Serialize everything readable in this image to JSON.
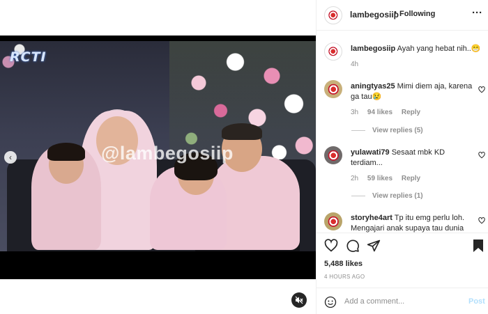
{
  "video": {
    "channel_logo": "RCTI",
    "watermark": "@lambegosiip",
    "prev_icon": "chevron-left-icon",
    "mute_icon": "speaker-muted-icon"
  },
  "header": {
    "username": "lambegosiip",
    "separator": "•",
    "follow_status": "Following",
    "more": "···"
  },
  "caption": {
    "username": "lambegosiip",
    "text": "Ayah yang hebat nih..😁",
    "time": "4h"
  },
  "comments": [
    {
      "username": "aningtyas25",
      "text": "Mimi diem aja, karena ga tau😢",
      "time": "3h",
      "likes": "94 likes",
      "reply_label": "Reply",
      "view_replies": "View replies (5)"
    },
    {
      "username": "yulawati79",
      "text": "Sesaat mbk KD terdiam...",
      "time": "2h",
      "likes": "59 likes",
      "reply_label": "Reply",
      "view_replies": "View replies (1)"
    },
    {
      "username": "storyhe4art",
      "text": "Tp itu emg perlu loh. Mengajari anak supaya tau dunia"
    }
  ],
  "actions": {
    "likes": "5,488 likes",
    "time": "4 HOURS AGO"
  },
  "composer": {
    "placeholder": "Add a comment...",
    "post_label": "Post"
  },
  "colors": {
    "link_blue_disabled": "#b2dffc",
    "text_primary": "#262626",
    "text_secondary": "#8e8e8e"
  }
}
